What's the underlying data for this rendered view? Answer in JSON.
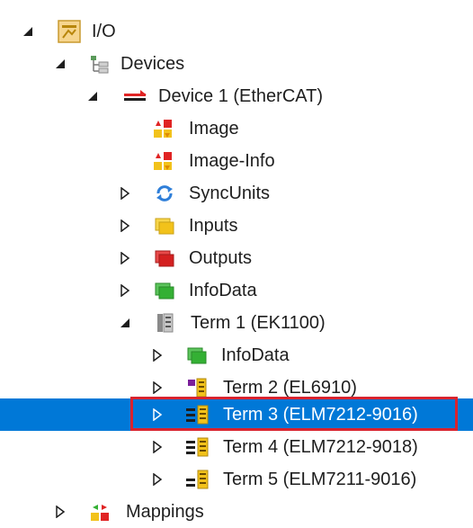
{
  "tree": {
    "io": {
      "label": "I/O",
      "icon": "io-folder-icon",
      "expanded": true
    },
    "devices": {
      "label": "Devices",
      "icon": "devices-tree-icon",
      "expanded": true
    },
    "device1": {
      "label": "Device 1 (EtherCAT)",
      "icon": "ethercat-device-icon",
      "expanded": true
    },
    "image": {
      "label": "Image",
      "icon": "image-icon"
    },
    "image_info": {
      "label": "Image-Info",
      "icon": "image-info-icon"
    },
    "syncunits": {
      "label": "SyncUnits",
      "icon": "sync-icon",
      "expanded": false
    },
    "inputs": {
      "label": "Inputs",
      "icon": "inputs-icon",
      "expanded": false
    },
    "outputs": {
      "label": "Outputs",
      "icon": "outputs-icon",
      "expanded": false
    },
    "infodata": {
      "label": "InfoData",
      "icon": "infodata-icon",
      "expanded": false
    },
    "term1": {
      "label": "Term 1 (EK1100)",
      "icon": "coupler-icon",
      "expanded": true
    },
    "term1_infodata": {
      "label": "InfoData",
      "icon": "infodata-icon",
      "expanded": false
    },
    "term2": {
      "label": "Term 2 (EL6910)",
      "icon": "terminal-icon",
      "expanded": false
    },
    "term3": {
      "label": "Term 3 (ELM7212-9016)",
      "icon": "terminal-icon",
      "expanded": false,
      "selected": true
    },
    "term4": {
      "label": "Term 4 (ELM7212-9018)",
      "icon": "terminal-icon",
      "expanded": false
    },
    "term5": {
      "label": "Term 5 (ELM7211-9016)",
      "icon": "terminal-icon",
      "expanded": false
    },
    "mappings": {
      "label": "Mappings",
      "icon": "mappings-icon",
      "expanded": false
    }
  },
  "colors": {
    "selection": "#0078d7",
    "highlight_border": "#d9232e"
  }
}
